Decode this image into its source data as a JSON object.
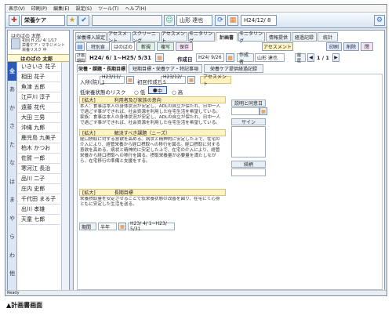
{
  "menu": [
    "表示(V)",
    "印刷(P)",
    "編集(E)",
    "設定(S)",
    "ツール(T)",
    "ヘルプ(H)"
  ],
  "toolbar": {
    "app_name": "栄養ケア",
    "user": "山形 達也",
    "date": "H24/12/ 8"
  },
  "sidebar": {
    "facility_label": "はのばの 太郎",
    "info_lines": [
      "初回 H 21/ 4/ 1/17",
      "栄養ケア・マネジメント",
      "栄養リスク 中"
    ],
    "selected_name": "はのばの 太郎",
    "alpha": [
      "全",
      "あ",
      "か",
      "さ",
      "た",
      "な",
      "は",
      "ま",
      "や",
      "ら",
      "わ",
      "他"
    ],
    "patients": [
      "いきいき 花子",
      "相田 花子",
      "魚津 五郎",
      "江戸川 淳子",
      "遠藤 花代",
      "大田 三男",
      "沖縄 九郎",
      "鹿児島 九美子",
      "柏木 かつお",
      "佐賀 一郎",
      "寒河江 長治",
      "品川 二子",
      "庄内 史郎",
      "千代田 まる子",
      "出川 孝雄",
      "天童 七郎"
    ]
  },
  "tabs": [
    "栄養導入設定",
    "アセスメント",
    "スクリーニング",
    "アセスメント",
    "モニタリング",
    "計画書",
    "モニタリング",
    "情報提供",
    "経過記録",
    "統計"
  ],
  "active_tab": "計画書",
  "actions": {
    "special": "特別食",
    "assessor": "はのばの",
    "new": "新規",
    "copy": "複写",
    "save": "保存",
    "assessment": "アセスメント",
    "print": "印刷",
    "delete": "削除",
    "close": "閉"
  },
  "plan": {
    "period_label": "計画期間",
    "period": "H24/ 6/ 1~H25/ 5/31",
    "created_label": "作成日",
    "created": "H24/ 9/26",
    "author_label": "作成者",
    "author": "山形 達也",
    "page_label": "履歴",
    "page": "1 / 1"
  },
  "subtabs": [
    "栄養・課題・長期目標",
    "短期目標・栄養ケア・特記事項",
    "栄養ケア提供経過記録"
  ],
  "form": {
    "admission_label": "入所(院)日",
    "admission": "H23/11/ 1",
    "first_label": "初回作成日",
    "first": "H23/12/ 5",
    "assessment_chip": "アセスメント",
    "risk_label": "低栄養状態のリスク",
    "risk_low": "低",
    "risk_mid": "中",
    "risk_high": "高",
    "box1_head": "利用者及び家族の意向",
    "box1_tag": "[拡大]",
    "box1_text": "本人：食事は本人の身体状況が安定し、ADLの自立が保たれ、日中一人で過ごす事ができれば、社会資源を利用した在宅生活を希望している。家族：食事は本人の身体状況が安定し、ADLの自立が保たれ、日中一人で過ごす事ができれば、社会資源を利用した在宅生活を希望している。",
    "box2_head": "解決すべき課題（ニーズ）",
    "box2_tag": "[拡大]",
    "box2_text": "経口摂取に対する意欲を高める。病状と精神的に安定した上で、在宅の介入により、経管栄養から経口摂取への移行を図る。経口摂取に対する意欲を高める。病状と精神的に安定した上で、在宅の介入により、経管栄養から経口摂取への移行を図る。摂取栄養量が必要量を満たしながら、在宅移行の準備と支援をする。",
    "box3_head": "長期目標",
    "box3_tag": "[拡大]",
    "box3_text": "栄養摂取量を安定させることで低栄養状態の改善を図り、在宅にて心身ともに安定した生活を送る。",
    "period_label": "期間",
    "period_unit": "半年",
    "period_value": "H23/ 4/ 1~H23/ 5/31",
    "right_explain": "説明と同意日",
    "right_sign": "サイン",
    "right_continue": "続柄"
  },
  "status": "Ready",
  "caption": "▲計画書画面"
}
